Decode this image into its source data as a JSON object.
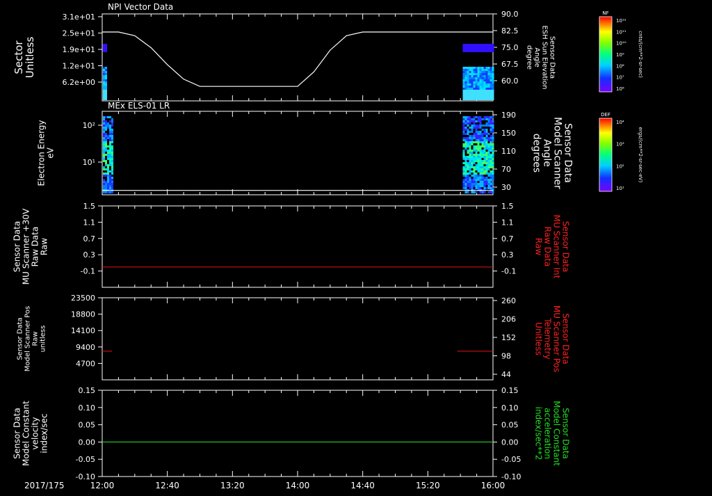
{
  "time_axis": {
    "date_label": "2017/175",
    "ticks": [
      "12:00",
      "12:40",
      "13:20",
      "14:00",
      "14:40",
      "15:20",
      "16:00"
    ],
    "range_minutes": [
      0,
      240
    ]
  },
  "colorbars": [
    {
      "tag": "NF",
      "unit": "cnts/(cm**2-sr-sec)",
      "labels": [
        "10¹²",
        "10¹¹",
        "10¹⁰",
        "10⁹",
        "10⁸",
        "10⁷",
        "10⁶"
      ]
    },
    {
      "tag": "DEF",
      "unit": "ergs/(cm**2-sr-sec-eV)",
      "labels": [
        "10⁴",
        "10³",
        "10²",
        "10¹"
      ]
    }
  ],
  "chart_data": [
    {
      "type": "heatmap",
      "title": "NPI Vector Data",
      "ylabel": "Sector\nUnitless",
      "yticks": [
        "3.1e+01",
        "2.5e+01",
        "1.9e+01",
        "1.2e+01",
        "6.2e+00"
      ],
      "y2label": "Sensor Data\nESH Sun Elevation\nAngle\ndegree",
      "y2ticks": [
        "90.0",
        "82.5",
        "75.0",
        "67.5",
        "60.0"
      ],
      "line_color": "#ffffff",
      "line_series": {
        "name": "ESH Sun Elevation Angle",
        "x": [
          0,
          10,
          20,
          30,
          40,
          50,
          60,
          70,
          80,
          90,
          100,
          110,
          120,
          130,
          140,
          150,
          160,
          170,
          180,
          190,
          200,
          210,
          220,
          230,
          240
        ],
        "y": [
          82.5,
          82.5,
          81,
          76,
          69,
          63,
          60,
          60,
          60,
          60,
          60,
          60,
          60,
          66,
          75,
          81,
          82.5,
          82.5,
          82.5,
          82.5,
          82.5,
          82.5,
          82.5,
          82.5,
          82.5
        ]
      },
      "y2lim": [
        54,
        90
      ],
      "data_intervals_minutes": [
        [
          0,
          3
        ],
        [
          221,
          240
        ]
      ]
    },
    {
      "type": "heatmap",
      "title": "MEx ELS-01 LR",
      "ylabel": "Electron Energy\neV",
      "yticks": [
        "10²",
        "10¹"
      ],
      "y2label": "Sensor Data\nModel Scanner\nAngle\ndegrees",
      "y2ticks": [
        "190",
        "150",
        "110",
        "70",
        "30"
      ],
      "line_color": "#ffffff",
      "line_series": {
        "name": "Model Scanner Angle",
        "x": [
          0,
          240
        ],
        "y": [
          10,
          10
        ]
      },
      "y2lim": [
        0,
        190
      ],
      "data_intervals_minutes": [
        [
          0,
          6
        ],
        [
          221,
          240
        ]
      ]
    },
    {
      "type": "line",
      "ylabel": "Sensor Data\nMU Scanner +30V\nRaw Data\nRaw",
      "yticks": [
        "1.5",
        "1.1",
        "0.7",
        "0.3",
        "-0.1"
      ],
      "ylim": [
        -0.5,
        1.5
      ],
      "y2label": "Sensor Data\nMU Scanner Int\nRaw Data\nRaw",
      "y2ticks": [
        "1.5",
        "1.1",
        "0.7",
        "0.3",
        "-0.1"
      ],
      "label_color": "#ff2020",
      "series": [
        {
          "name": "MU Scanner Int Raw Data",
          "color": "#d01010",
          "x": [
            0,
            240
          ],
          "y": [
            0,
            0
          ]
        }
      ]
    },
    {
      "type": "line",
      "ylabel": "Sensor Data\nModel Scanner Pos\nRaw\nunitless",
      "yticks": [
        "23500",
        "18800",
        "14100",
        "9400",
        "4700"
      ],
      "ylim": [
        0,
        23500
      ],
      "y2label": "Sensor Data\nMU Scanner Pos\nTelemetry\nUnitless",
      "y2ticks": [
        "260",
        "206",
        "152",
        "98",
        "44"
      ],
      "label_color": "#ff2020",
      "series": [
        {
          "name": "MU Scanner Pos Telemetry",
          "color": "#d01010",
          "x": [
            0,
            6,
            null,
            218,
            240
          ],
          "y": [
            8200,
            8200,
            null,
            8200,
            8200
          ]
        }
      ]
    },
    {
      "type": "line",
      "ylabel": "Sensor Data\nModel Constant\nvelocity\nindex/sec",
      "yticks": [
        "0.15",
        "0.10",
        "0.05",
        "0.00",
        "-0.05",
        "-0.10"
      ],
      "ylim": [
        -0.1,
        0.15
      ],
      "y2label": "Sensor Data\nModel Constant\nacceleration\nindex/sec**2",
      "y2ticks": [
        "0.15",
        "0.10",
        "0.05",
        "0.00",
        "-0.05",
        "-0.10"
      ],
      "label_color": "#20e020",
      "series": [
        {
          "name": "Model Constant acceleration",
          "color": "#20c020",
          "x": [
            0,
            240
          ],
          "y": [
            0,
            0
          ]
        }
      ]
    }
  ]
}
